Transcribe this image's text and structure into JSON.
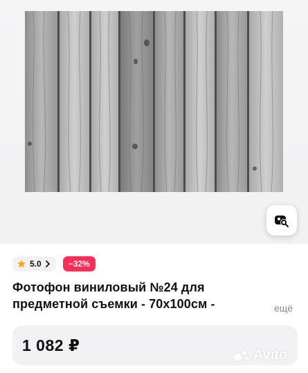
{
  "product": {
    "rating": "5.0",
    "discount": "−32%",
    "title_line1": "Фотофон виниловый №24 для",
    "title_line2": "предметной съемки - 70х100см -",
    "more_label": "ещё",
    "price": "1 082 ₽"
  },
  "branding": {
    "logo_text": "Avito"
  },
  "icons": {
    "rating": "star-icon",
    "chevron": "chevron-right-icon",
    "lens": "image-search-icon",
    "logo": "avito-dots-icon"
  },
  "colors": {
    "discount": "#ff2d55",
    "star": "#f7a600",
    "badge_bg": "#f2f2f4"
  }
}
